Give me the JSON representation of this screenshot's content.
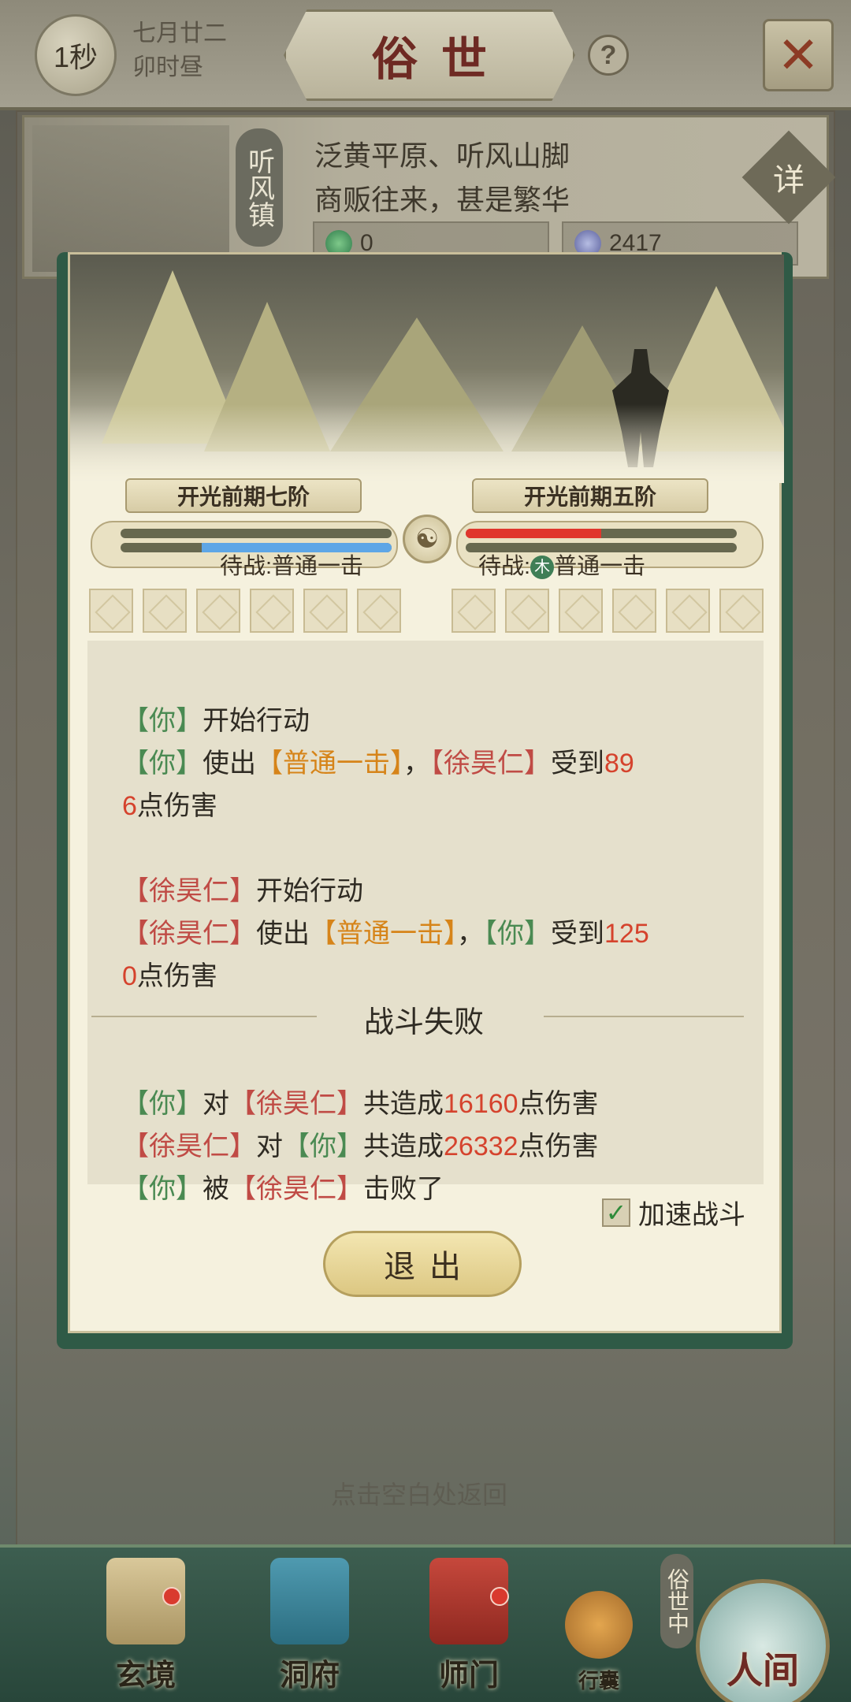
{
  "top_bar": {
    "timer": "1秒",
    "lunar_date": "七月廿二",
    "time_of_day": "卯时昼",
    "title": "俗世",
    "help_icon": "question-icon",
    "close_icon": "crossed-swords-close-icon"
  },
  "location": {
    "name": "听风镇",
    "desc_line1": "泛黄平原、听风山脚",
    "desc_line2": "商贩往来，甚是繁华",
    "detail_label": "详",
    "jade_value": "0",
    "spirit_stone_value": "2417"
  },
  "battle": {
    "player": {
      "rank": "开光前期七阶",
      "standby": "待战:普通一击",
      "hp_fraction": 0.0,
      "mp_fraction": 0.3
    },
    "enemy": {
      "rank": "开光前期五阶",
      "standby_prefix": "待战:",
      "element": "木",
      "standby_skill": "普通一击",
      "hp_fraction": 0.5,
      "mp_fraction": 0.0
    },
    "log": {
      "l1_you": "【你】",
      "l1_text": "开始行动",
      "l2_you": "【你】",
      "l2_text1": "使出",
      "l2_skill": "【普通一击】",
      "l2_comma": "，",
      "l2_enemy": "【徐昊仁】",
      "l2_text2": "受到",
      "l2_dmg_a": "89",
      "l3_dmg_b": "6",
      "l3_text": "点伤害",
      "l4_enemy": "【徐昊仁】",
      "l4_text": "开始行动",
      "l5_enemy": "【徐昊仁】",
      "l5_text1": "使出",
      "l5_skill": "【普通一击】",
      "l5_comma": "，",
      "l5_you": "【你】",
      "l5_text2": "受到",
      "l5_dmg_a": "125",
      "l6_dmg_b": "0",
      "l6_text": "点伤害"
    },
    "result_title": "战斗失败",
    "summary": {
      "s1_you": "【你】",
      "s1_dui": "对",
      "s1_enemy": "【徐昊仁】",
      "s1_text": "共造成",
      "s1_dmg": "16160",
      "s1_unit": "点伤害",
      "s2_enemy": "【徐昊仁】",
      "s2_dui": "对",
      "s2_you": "【你】",
      "s2_text": "共造成",
      "s2_dmg": "26332",
      "s2_unit": "点伤害",
      "s3_you": "【你】",
      "s3_bei": "被",
      "s3_enemy": "【徐昊仁】",
      "s3_text": "击败了"
    },
    "speed_label": "加速战斗",
    "speed_checked": true,
    "exit_label": "退出"
  },
  "tap_hint": "点击空白处返回",
  "nav": {
    "xuanjing": "玄境",
    "dongfu": "洞府",
    "shimen": "师门",
    "xingnang": "行囊",
    "renjian": "人间",
    "status_tag": "俗世中"
  },
  "colors": {
    "friendly": "#4a8a52",
    "enemy": "#c04b45",
    "skill": "#d68419",
    "damage": "#d5432d",
    "hp_bar": "#e0362d",
    "mp_bar": "#5ea6e6"
  }
}
